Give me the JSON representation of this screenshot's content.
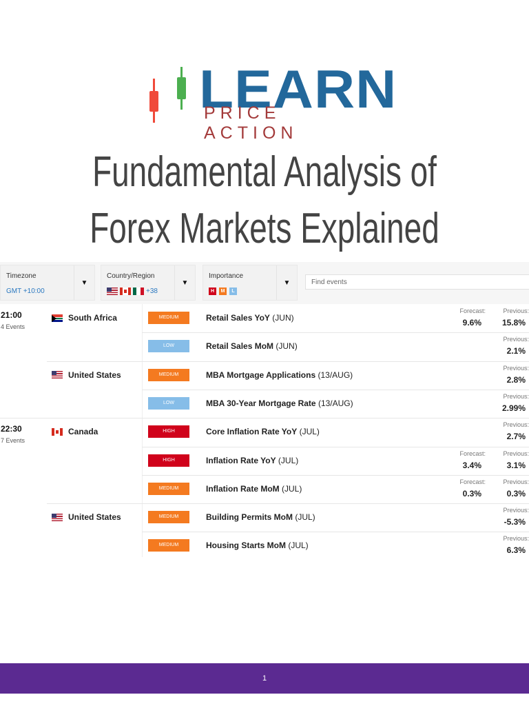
{
  "logo": {
    "main": "LEARN",
    "sub": "PRICE ACTION",
    "colors": {
      "blue": "#23689b",
      "red": "#a33a3a",
      "candle_red": "#f04a3a",
      "candle_green": "#4caf50"
    }
  },
  "title": {
    "line1": "Fundamental Analysis of",
    "line2": "Forex Markets Explained"
  },
  "filters": {
    "timezone": {
      "label": "Timezone",
      "value": "GMT +10:00"
    },
    "country": {
      "label": "Country/Region",
      "extra": "+38"
    },
    "importance": {
      "label": "Importance",
      "levels": [
        "H",
        "M",
        "L"
      ]
    },
    "search": {
      "placeholder": "Find events"
    }
  },
  "groups": [
    {
      "time": "21:00",
      "count": "4 Events"
    },
    {
      "time": "22:30",
      "count": "7 Events"
    }
  ],
  "countries": [
    "South Africa",
    "United States",
    "Canada",
    "United States"
  ],
  "events": [
    {
      "importance": "MEDIUM",
      "name": "Retail Sales YoY",
      "period": "(JUN)",
      "forecast_label": "Forecast:",
      "forecast": "9.6%",
      "previous_label": "Previous:",
      "previous": "15.8%"
    },
    {
      "importance": "LOW",
      "name": "Retail Sales MoM",
      "period": "(JUN)",
      "previous_label": "Previous:",
      "previous": "2.1%"
    },
    {
      "importance": "MEDIUM",
      "name": "MBA Mortgage Applications",
      "period": "(13/AUG)",
      "previous_label": "Previous:",
      "previous": "2.8%"
    },
    {
      "importance": "LOW",
      "name": "MBA 30-Year Mortgage Rate",
      "period": "(13/AUG)",
      "previous_label": "Previous:",
      "previous": "2.99%"
    },
    {
      "importance": "HIGH",
      "name": "Core Inflation Rate YoY",
      "period": "(JUL)",
      "previous_label": "Previous:",
      "previous": "2.7%"
    },
    {
      "importance": "HIGH",
      "name": "Inflation Rate YoY",
      "period": "(JUL)",
      "forecast_label": "Forecast:",
      "forecast": "3.4%",
      "previous_label": "Previous:",
      "previous": "3.1%"
    },
    {
      "importance": "MEDIUM",
      "name": "Inflation Rate MoM",
      "period": "(JUL)",
      "forecast_label": "Forecast:",
      "forecast": "0.3%",
      "previous_label": "Previous:",
      "previous": "0.3%"
    },
    {
      "importance": "MEDIUM",
      "name": "Building Permits MoM",
      "period": "(JUL)",
      "previous_label": "Previous:",
      "previous": "-5.3%"
    },
    {
      "importance": "MEDIUM",
      "name": "Housing Starts MoM",
      "period": "(JUL)",
      "previous_label": "Previous:",
      "previous": "6.3%"
    }
  ],
  "importance_colors": {
    "HIGH": "#d0021b",
    "MEDIUM": "#f47a20",
    "LOW": "#86bde8"
  },
  "footer": {
    "page": "1",
    "color": "#5b2a91"
  }
}
